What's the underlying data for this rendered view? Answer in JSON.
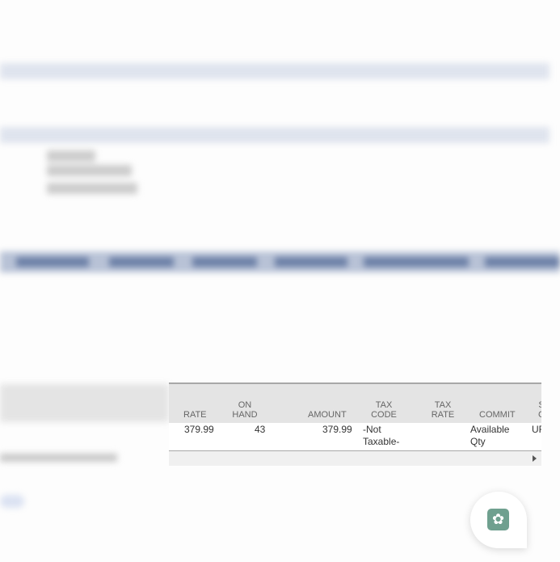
{
  "line_items": {
    "columns": [
      {
        "key": "rate",
        "label": "RATE"
      },
      {
        "key": "on_hand",
        "label": "ON HAND"
      },
      {
        "key": "amount",
        "label": "AMOUNT"
      },
      {
        "key": "tax_code",
        "label": "TAX CODE"
      },
      {
        "key": "tax_rate",
        "label": "TAX RATE"
      },
      {
        "key": "commit",
        "label": "COMMIT"
      },
      {
        "key": "s",
        "label": "S C"
      }
    ],
    "rows": [
      {
        "rate": "379.99",
        "on_hand": "43",
        "amount": "379.99",
        "tax_code": "-Not Taxable-",
        "tax_rate": "",
        "commit": "Available Qty",
        "s": "UF"
      }
    ]
  },
  "chat_widget": {
    "icon": "openai-logo-icon"
  },
  "colors": {
    "nav_band": "#b8c2d6",
    "section_band": "#dfe4ee",
    "chat_logo": "#6fa08f"
  }
}
